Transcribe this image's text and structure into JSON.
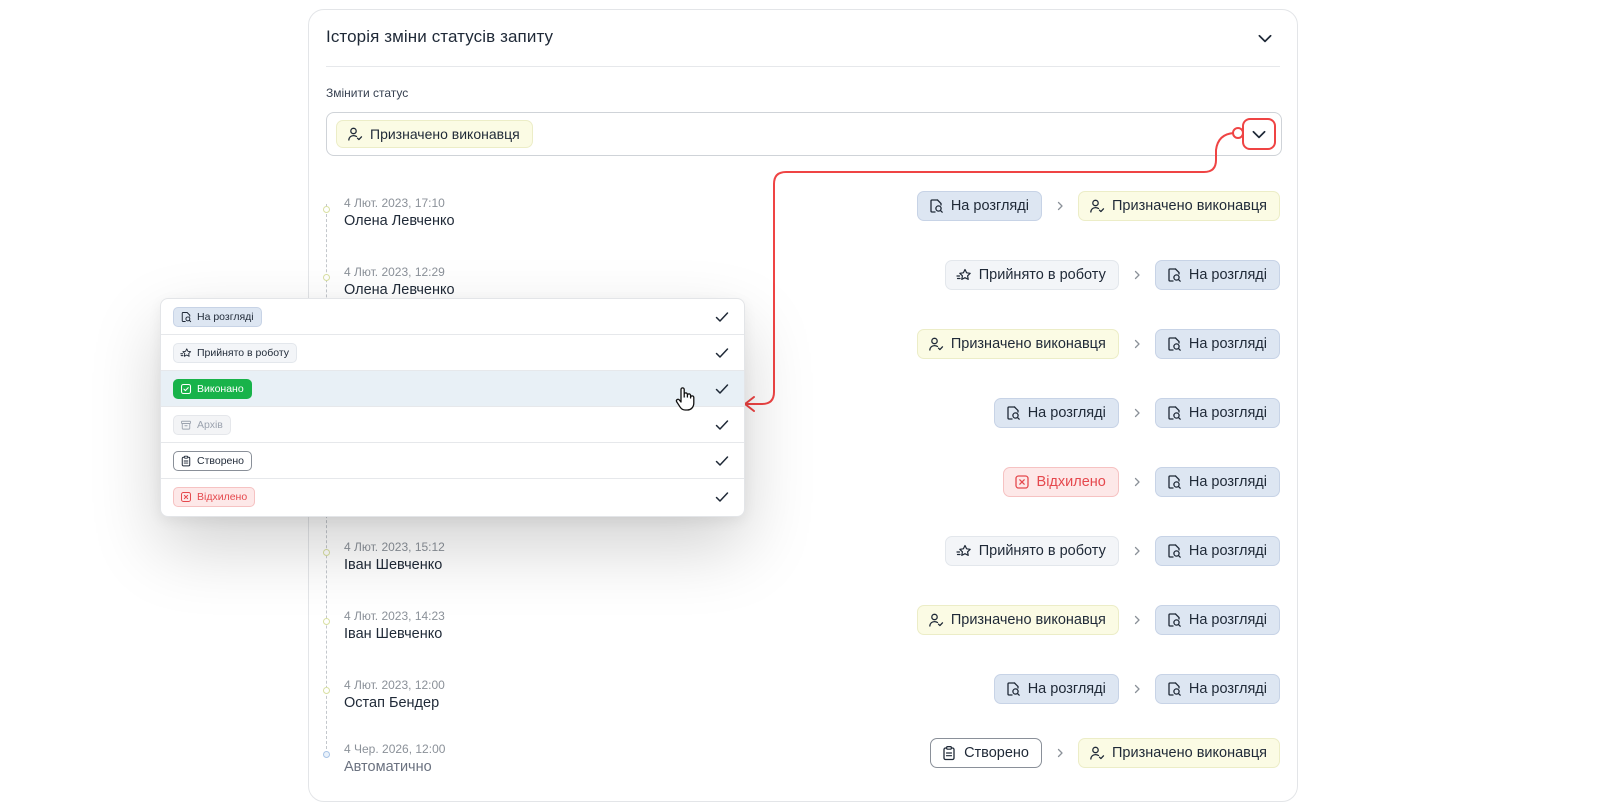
{
  "card": {
    "title": "Історія зміни статусів запиту"
  },
  "status_field": {
    "label": "Змінити статус",
    "selected_value": "Призначено виконавця"
  },
  "history": [
    {
      "date": "4 Лют. 2023, 17:10",
      "user": "Олена Левченко",
      "from": "На розгляді",
      "to": "Призначено виконавця"
    },
    {
      "date": "4 Лют. 2023, 12:29",
      "user": "Олена Левченко",
      "from": "Прийнято в роботу",
      "to": "На розгляді"
    },
    {
      "from": "Призначено виконавця",
      "to": "На розгляді"
    },
    {
      "from": "На розгляді",
      "to": "На розгляді"
    },
    {
      "from": "Відхилено",
      "to": "На розгляді"
    },
    {
      "date": "4 Лют. 2023, 15:12",
      "user": "Іван Шевченко",
      "from": "Прийнято в роботу",
      "to": "На розгляді"
    },
    {
      "date": "4 Лют. 2023, 14:23",
      "user": "Іван Шевченко",
      "from": "Призначено виконавця",
      "to": "На розгляді"
    },
    {
      "date": "4 Лют. 2023, 12:00",
      "user": "Остап Бендер",
      "from": "На розгляді",
      "to": "На розгляді"
    },
    {
      "date": "4 Чер. 2026, 12:00",
      "user": "Автоматично",
      "from": "Створено",
      "to": "Призначено виконавця"
    }
  ],
  "dropdown_options": [
    {
      "label": "На розгляді"
    },
    {
      "label": "Прийнято в роботу"
    },
    {
      "label": "Виконано"
    },
    {
      "label": "Архів"
    },
    {
      "label": "Створено"
    },
    {
      "label": "Відхилено"
    }
  ],
  "colors": {
    "highlight_red": "#ef4444",
    "review_bg": "#dde6f2",
    "assigned_bg": "#fbfbe4",
    "rejected_bg": "#fde8e8",
    "done_green": "#18b34a"
  },
  "icons": {
    "review": "search-document-icon",
    "assigned": "user-check-icon",
    "accepted": "star-speed-icon",
    "rejected": "x-square-icon",
    "created": "clipboard-icon",
    "done": "check-square-icon",
    "archive": "archive-icon",
    "separator": "chevron-right-icon",
    "check": "check-icon"
  }
}
